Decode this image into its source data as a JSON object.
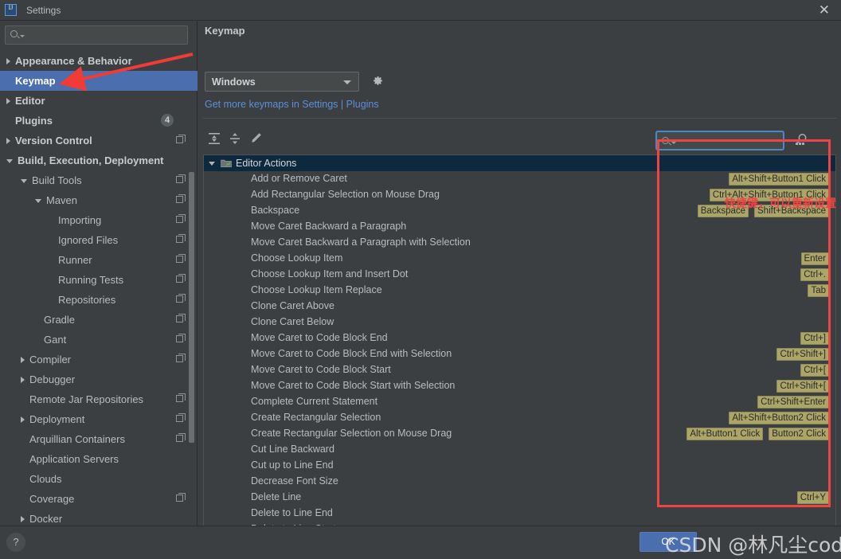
{
  "titlebar": {
    "app_icon": "intellij-logo-icon",
    "title": "Settings",
    "close_label": "✕"
  },
  "sidebar": {
    "search": {
      "value": "",
      "placeholder": ""
    },
    "items": [
      {
        "label": "Appearance & Behavior",
        "indent": 0,
        "arrow": "collapsed",
        "bold": true,
        "selected": false,
        "copy": false,
        "count": null
      },
      {
        "label": "Keymap",
        "indent": 0,
        "arrow": "none",
        "bold": true,
        "selected": true,
        "copy": false,
        "count": null
      },
      {
        "label": "Editor",
        "indent": 0,
        "arrow": "collapsed",
        "bold": true,
        "selected": false,
        "copy": false,
        "count": null
      },
      {
        "label": "Plugins",
        "indent": 0,
        "arrow": "none",
        "bold": true,
        "selected": false,
        "copy": false,
        "count": "4"
      },
      {
        "label": "Version Control",
        "indent": 0,
        "arrow": "collapsed",
        "bold": true,
        "selected": false,
        "copy": true,
        "count": null
      },
      {
        "label": "Build, Execution, Deployment",
        "indent": 0,
        "arrow": "expanded",
        "bold": true,
        "selected": false,
        "copy": false,
        "count": null
      },
      {
        "label": "Build Tools",
        "indent": 1,
        "arrow": "expanded",
        "bold": false,
        "selected": false,
        "copy": true,
        "count": null
      },
      {
        "label": "Maven",
        "indent": 2,
        "arrow": "expanded",
        "bold": false,
        "selected": false,
        "copy": true,
        "count": null
      },
      {
        "label": "Importing",
        "indent": 3,
        "arrow": "none",
        "bold": false,
        "selected": false,
        "copy": true,
        "count": null
      },
      {
        "label": "Ignored Files",
        "indent": 3,
        "arrow": "none",
        "bold": false,
        "selected": false,
        "copy": true,
        "count": null
      },
      {
        "label": "Runner",
        "indent": 3,
        "arrow": "none",
        "bold": false,
        "selected": false,
        "copy": true,
        "count": null
      },
      {
        "label": "Running Tests",
        "indent": 3,
        "arrow": "none",
        "bold": false,
        "selected": false,
        "copy": true,
        "count": null
      },
      {
        "label": "Repositories",
        "indent": 3,
        "arrow": "none",
        "bold": false,
        "selected": false,
        "copy": true,
        "count": null
      },
      {
        "label": "Gradle",
        "indent": 2,
        "arrow": "none",
        "bold": false,
        "selected": false,
        "copy": true,
        "count": null
      },
      {
        "label": "Gant",
        "indent": 2,
        "arrow": "none",
        "bold": false,
        "selected": false,
        "copy": true,
        "count": null
      },
      {
        "label": "Compiler",
        "indent": 1,
        "arrow": "collapsed",
        "bold": false,
        "selected": false,
        "copy": true,
        "count": null
      },
      {
        "label": "Debugger",
        "indent": 1,
        "arrow": "collapsed",
        "bold": false,
        "selected": false,
        "copy": false,
        "count": null
      },
      {
        "label": "Remote Jar Repositories",
        "indent": 1,
        "arrow": "none",
        "bold": false,
        "selected": false,
        "copy": true,
        "count": null
      },
      {
        "label": "Deployment",
        "indent": 1,
        "arrow": "collapsed",
        "bold": false,
        "selected": false,
        "copy": true,
        "count": null
      },
      {
        "label": "Arquillian Containers",
        "indent": 1,
        "arrow": "none",
        "bold": false,
        "selected": false,
        "copy": true,
        "count": null
      },
      {
        "label": "Application Servers",
        "indent": 1,
        "arrow": "none",
        "bold": false,
        "selected": false,
        "copy": false,
        "count": null
      },
      {
        "label": "Clouds",
        "indent": 1,
        "arrow": "none",
        "bold": false,
        "selected": false,
        "copy": false,
        "count": null
      },
      {
        "label": "Coverage",
        "indent": 1,
        "arrow": "none",
        "bold": false,
        "selected": false,
        "copy": true,
        "count": null
      },
      {
        "label": "Docker",
        "indent": 1,
        "arrow": "collapsed",
        "bold": false,
        "selected": false,
        "copy": false,
        "count": null
      }
    ]
  },
  "pane": {
    "title": "Keymap",
    "keymap_select": {
      "value": "Windows",
      "options": [
        "Windows"
      ]
    },
    "gear_icon": "gear-icon",
    "link": "Get more keymaps in Settings | Plugins",
    "toolbar": [
      {
        "icon": "expand-all-icon"
      },
      {
        "icon": "collapse-all-icon"
      },
      {
        "icon": "edit-pencil-icon"
      }
    ],
    "find": {
      "value": "",
      "placeholder": ""
    },
    "find_by_shortcut_icon": "find-by-shortcut-icon",
    "group": {
      "label": "Editor Actions",
      "icon": "folder-icon",
      "expanded": true
    },
    "actions": [
      {
        "name": "Add or Remove Caret",
        "shortcuts": [
          "Alt+Shift+Button1 Click"
        ]
      },
      {
        "name": "Add Rectangular Selection on Mouse Drag",
        "shortcuts": [
          "Ctrl+Alt+Shift+Button1 Click"
        ]
      },
      {
        "name": "Backspace",
        "shortcuts": [
          "Backspace",
          "Shift+Backspace"
        ]
      },
      {
        "name": "Move Caret Backward a Paragraph",
        "shortcuts": []
      },
      {
        "name": "Move Caret Backward a Paragraph with Selection",
        "shortcuts": []
      },
      {
        "name": "Choose Lookup Item",
        "shortcuts": [
          "Enter"
        ]
      },
      {
        "name": "Choose Lookup Item and Insert Dot",
        "shortcuts": [
          "Ctrl+."
        ]
      },
      {
        "name": "Choose Lookup Item Replace",
        "shortcuts": [
          "Tab"
        ]
      },
      {
        "name": "Clone Caret Above",
        "shortcuts": []
      },
      {
        "name": "Clone Caret Below",
        "shortcuts": []
      },
      {
        "name": "Move Caret to Code Block End",
        "shortcuts": [
          "Ctrl+]"
        ]
      },
      {
        "name": "Move Caret to Code Block End with Selection",
        "shortcuts": [
          "Ctrl+Shift+]"
        ]
      },
      {
        "name": "Move Caret to Code Block Start",
        "shortcuts": [
          "Ctrl+["
        ]
      },
      {
        "name": "Move Caret to Code Block Start with Selection",
        "shortcuts": [
          "Ctrl+Shift+["
        ]
      },
      {
        "name": "Complete Current Statement",
        "shortcuts": [
          "Ctrl+Shift+Enter"
        ]
      },
      {
        "name": "Create Rectangular Selection",
        "shortcuts": [
          "Alt+Shift+Button2 Click"
        ]
      },
      {
        "name": "Create Rectangular Selection on Mouse Drag",
        "shortcuts": [
          "Alt+Button1 Click",
          "Button2 Click"
        ]
      },
      {
        "name": "Cut Line Backward",
        "shortcuts": []
      },
      {
        "name": "Cut up to Line End",
        "shortcuts": []
      },
      {
        "name": "Decrease Font Size",
        "shortcuts": []
      },
      {
        "name": "Delete Line",
        "shortcuts": [
          "Ctrl+Y"
        ]
      },
      {
        "name": "Delete to Line End",
        "shortcuts": []
      },
      {
        "name": "Delete to Line Start",
        "shortcuts": []
      }
    ]
  },
  "annotations": {
    "note": "快捷键，可以重新设置",
    "highlight_color": "#ef4444",
    "arrow_target": "Keymap"
  },
  "bottombar": {
    "help_label": "?",
    "ok_label": "OK",
    "watermark": "CSDN @林凡尘coding"
  }
}
